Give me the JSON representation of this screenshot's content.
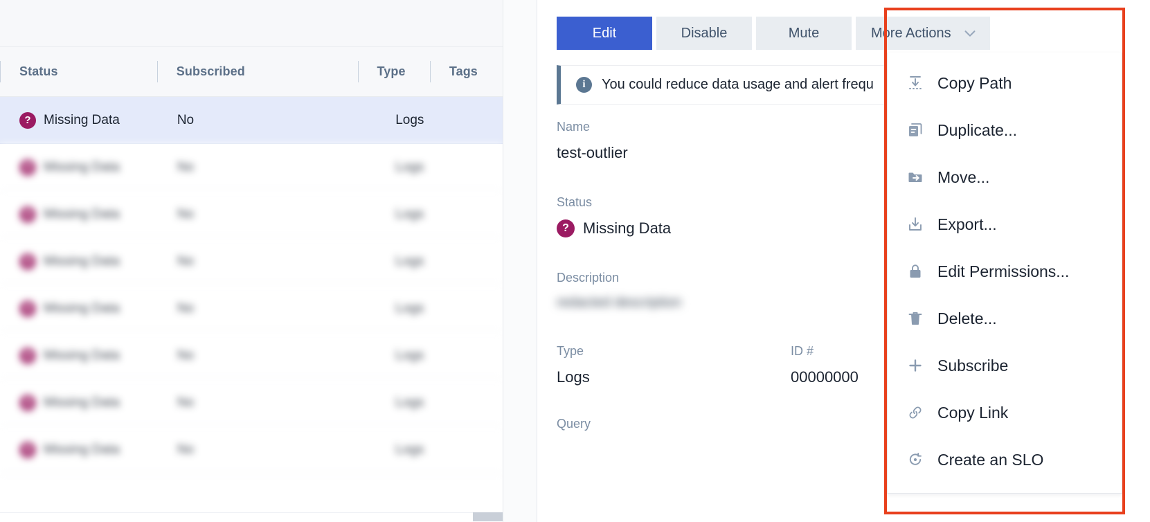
{
  "alerts_table": {
    "columns": [
      "Status",
      "Subscribed",
      "Type",
      "Tags"
    ],
    "rows": [
      {
        "status": "Missing Data",
        "status_icon": "question-circle-icon",
        "subscribed": "No",
        "type": "Logs",
        "tags": "",
        "selected": true,
        "redacted": false
      },
      {
        "status": "Missing Data",
        "status_icon": "question-circle-icon",
        "subscribed": "No",
        "type": "Logs",
        "tags": "",
        "selected": false,
        "redacted": true
      },
      {
        "status": "Missing Data",
        "status_icon": "question-circle-icon",
        "subscribed": "No",
        "type": "Logs",
        "tags": "",
        "selected": false,
        "redacted": true
      },
      {
        "status": "Missing Data",
        "status_icon": "question-circle-icon",
        "subscribed": "No",
        "type": "Logs",
        "tags": "",
        "selected": false,
        "redacted": true
      },
      {
        "status": "Missing Data",
        "status_icon": "question-circle-icon",
        "subscribed": "No",
        "type": "Logs",
        "tags": "",
        "selected": false,
        "redacted": true
      },
      {
        "status": "Missing Data",
        "status_icon": "question-circle-icon",
        "subscribed": "No",
        "type": "Logs",
        "tags": "",
        "selected": false,
        "redacted": true
      },
      {
        "status": "Missing Data",
        "status_icon": "question-circle-icon",
        "subscribed": "No",
        "type": "Logs",
        "tags": "",
        "selected": false,
        "redacted": true
      },
      {
        "status": "Missing Data",
        "status_icon": "question-circle-icon",
        "subscribed": "No",
        "type": "Logs",
        "tags": "",
        "selected": false,
        "redacted": true
      }
    ]
  },
  "detail": {
    "actions": {
      "edit": "Edit",
      "disable": "Disable",
      "mute": "Mute",
      "more_actions": "More Actions"
    },
    "banner": {
      "text": "You could reduce data usage and alert frequ"
    },
    "fields": {
      "name_label": "Name",
      "name_value": "test-outlier",
      "status_label": "Status",
      "status_value": "Missing Data",
      "description_label": "Description",
      "description_value": "redacted description",
      "type_label": "Type",
      "type_value": "Logs",
      "id_label": "ID #",
      "id_value": "00000000",
      "query_label": "Query"
    }
  },
  "more_actions_menu": {
    "items": [
      {
        "label": "Copy Path",
        "icon": "copy-path-icon"
      },
      {
        "label": "Duplicate...",
        "icon": "duplicate-icon"
      },
      {
        "label": "Move...",
        "icon": "move-folder-icon"
      },
      {
        "label": "Export...",
        "icon": "export-icon"
      },
      {
        "label": "Edit Permissions...",
        "icon": "lock-icon"
      },
      {
        "label": "Delete...",
        "icon": "trash-icon"
      },
      {
        "label": "Subscribe",
        "icon": "plus-icon"
      },
      {
        "label": "Copy Link",
        "icon": "link-icon"
      },
      {
        "label": "Create an SLO",
        "icon": "slo-target-icon"
      }
    ]
  },
  "colors": {
    "primary_button": "#3b5fd0",
    "highlight_box": "#e8401d",
    "selected_row": "#e4eafa",
    "status_missing_data": "#9b1b62",
    "header_text": "#5c7088"
  }
}
